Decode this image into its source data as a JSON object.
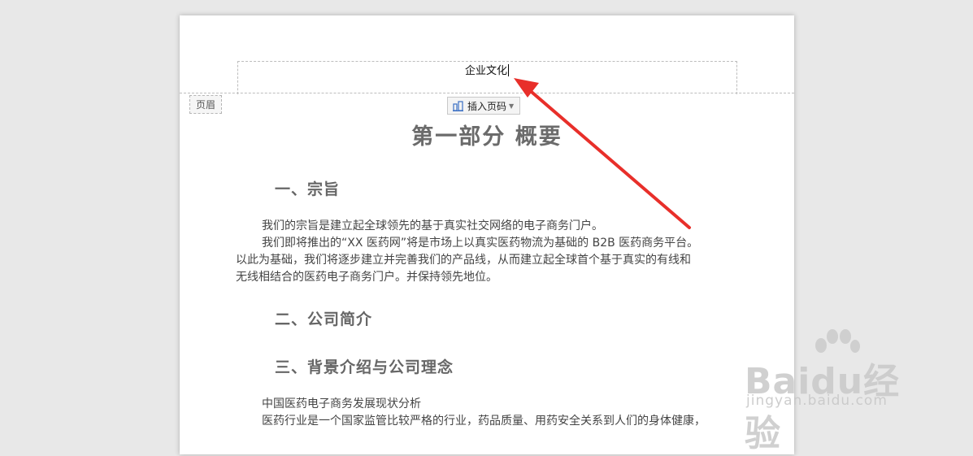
{
  "header": {
    "text": "企业文化",
    "tag": "页眉",
    "insert_page_number": "插入页码"
  },
  "document": {
    "title": "第一部分  概要",
    "sections": [
      {
        "heading": "一、宗旨"
      },
      {
        "heading": "二、公司简介"
      },
      {
        "heading": "三、背景介绍与公司理念"
      }
    ],
    "paragraphs": {
      "p1": "我们的宗旨是建立起全球领先的基于真实社交网络的电子商务门户。",
      "p2a": "我们即将推出的“XX 医药网”将是市场上以真实医药物流为基础的 B2B 医药商务平台。",
      "p2b": "以此为基础，我们将逐步建立并完善我们的产品线，从而建立起全球首个基于真实的有线和",
      "p2c": "无线相结合的医药电子商务门户。并保持领先地位。",
      "p3": "中国医药电子商务发展现状分析",
      "p4": "医药行业是一个国家监管比较严格的行业，药品质量、用药安全关系到人们的身体健康，"
    }
  },
  "watermark": {
    "brand": "Baidu经验",
    "url": "jingyan.baidu.com"
  },
  "colors": {
    "arrow": "#e82f2a",
    "background": "#e8e8e8"
  }
}
